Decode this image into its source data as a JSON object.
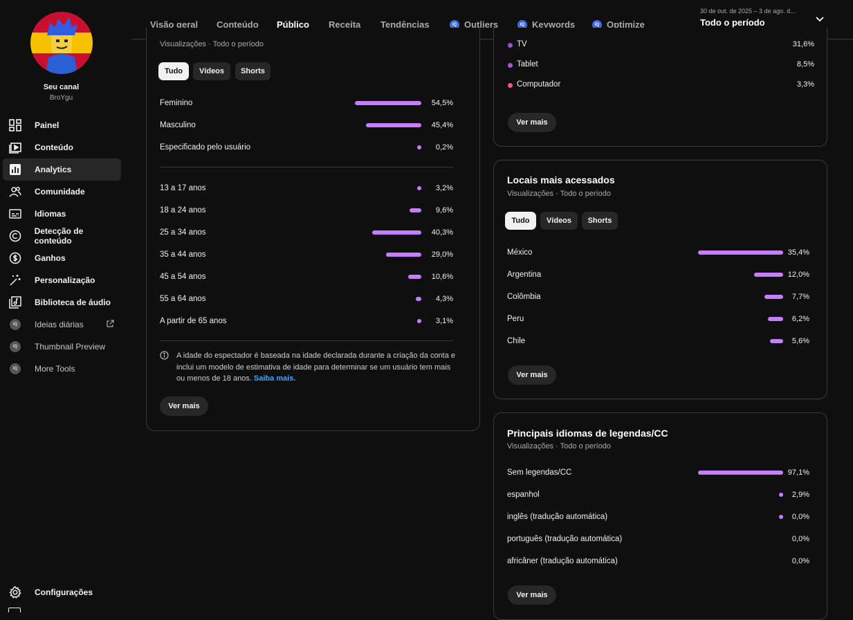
{
  "sidebar": {
    "channel_name": "Seu canal",
    "channel_handle": "BroYgu",
    "items": [
      {
        "label": "Painel",
        "icon": "dashboard-icon"
      },
      {
        "label": "Conteúdo",
        "icon": "content-icon"
      },
      {
        "label": "Analytics",
        "icon": "analytics-icon"
      },
      {
        "label": "Comunidade",
        "icon": "community-icon"
      },
      {
        "label": "Idiomas",
        "icon": "subtitles-icon"
      },
      {
        "label": "Detecção de conteúdo",
        "icon": "copyright-icon"
      },
      {
        "label": "Ganhos",
        "icon": "dollar-icon"
      },
      {
        "label": "Personalização",
        "icon": "magic-wand-icon"
      },
      {
        "label": "Biblioteca de áudio",
        "icon": "audio-library-icon"
      }
    ],
    "extensions": [
      {
        "label": "Ideias diárias",
        "icon": "vidiq-icon"
      },
      {
        "label": "Thumbnail Preview",
        "icon": "vidiq-icon"
      },
      {
        "label": "More Tools",
        "icon": "vidiq-icon"
      }
    ],
    "bottom": {
      "settings_label": "Configurações"
    },
    "extension_badge": "IQ"
  },
  "header": {
    "tabs": [
      {
        "label": "Visão geral"
      },
      {
        "label": "Conteúdo"
      },
      {
        "label": "Público"
      },
      {
        "label": "Receita"
      },
      {
        "label": "Tendências"
      },
      {
        "label": "Outliers"
      },
      {
        "label": "Keywords"
      },
      {
        "label": "Optimize"
      }
    ],
    "period_range": "30 de out. de 2025 – 3 de ago. d...",
    "period_label": "Todo o período"
  },
  "demographics": {
    "subtitle": "Visualizações · Todo o período",
    "chips": [
      "Tudo",
      "Vídeos",
      "Shorts"
    ],
    "gender": [
      {
        "label": "Feminino",
        "value": "54,5%",
        "pct": 54.5
      },
      {
        "label": "Masculino",
        "value": "45,4%",
        "pct": 45.4
      },
      {
        "label": "Especificado pelo usuário",
        "value": "0,2%",
        "pct": 0.2
      }
    ],
    "age": [
      {
        "label": "13 a 17 anos",
        "value": "3,2%",
        "pct": 3.2
      },
      {
        "label": "18 a 24 anos",
        "value": "9,6%",
        "pct": 9.6
      },
      {
        "label": "25 a 34 anos",
        "value": "40,3%",
        "pct": 40.3
      },
      {
        "label": "35 a 44 anos",
        "value": "29,0%",
        "pct": 29.0
      },
      {
        "label": "45 a 54 anos",
        "value": "10,6%",
        "pct": 10.6
      },
      {
        "label": "55 a 64 anos",
        "value": "4,3%",
        "pct": 4.3
      },
      {
        "label": "A partir de 65 anos",
        "value": "3,1%",
        "pct": 3.1
      }
    ],
    "note": "A idade do espectador é baseada na idade declarada durante a criação da conta e inclui um modelo de estimativa de idade para determinar se um usuário tem mais ou menos de 18 anos.",
    "note_link": "Saiba mais.",
    "see_more": "Ver mais"
  },
  "devices": {
    "rows": [
      {
        "label": "TV",
        "value": "31,6%",
        "color": "#9c4dcc"
      },
      {
        "label": "Tablet",
        "value": "8,5%",
        "color": "#b04fd8"
      },
      {
        "label": "Computador",
        "value": "3,3%",
        "color": "#e8579a"
      }
    ],
    "see_more": "Ver mais"
  },
  "locations": {
    "title": "Locais mais acessados",
    "subtitle": "Visualizações · Todo o período",
    "chips": [
      "Tudo",
      "Vídeos",
      "Shorts"
    ],
    "rows": [
      {
        "label": "México",
        "value": "35,4%",
        "pct": 35.4
      },
      {
        "label": "Argentina",
        "value": "12,0%",
        "pct": 12.0
      },
      {
        "label": "Colômbia",
        "value": "7,7%",
        "pct": 7.7
      },
      {
        "label": "Peru",
        "value": "6,2%",
        "pct": 6.2
      },
      {
        "label": "Chile",
        "value": "5,6%",
        "pct": 5.6
      }
    ],
    "see_more": "Ver mais"
  },
  "subtitles": {
    "title": "Principais idiomas de legendas/CC",
    "subtitle": "Visualizações · Todo o período",
    "rows": [
      {
        "label": "Sem legendas/CC",
        "value": "97,1%",
        "pct": 97.1
      },
      {
        "label": "espanhol",
        "value": "2,9%",
        "pct": 2.9
      },
      {
        "label": "inglês (tradução automática)",
        "value": "0,0%",
        "pct": 0.0,
        "dot": true
      },
      {
        "label": "português (tradução automática)",
        "value": "0,0%",
        "pct": 0.0,
        "dot": false
      },
      {
        "label": "africâner (tradução automática)",
        "value": "0,0%",
        "pct": 0.0,
        "dot": false
      }
    ],
    "see_more": "Ver mais"
  },
  "colors": {
    "accent_bar": "#c77dff",
    "link": "#3ea6ff"
  }
}
